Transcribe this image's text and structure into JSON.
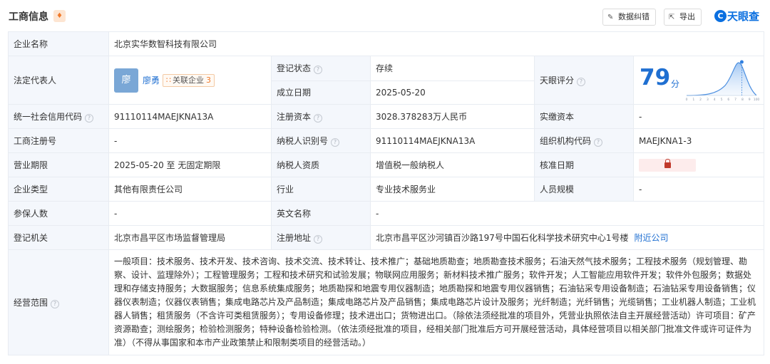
{
  "header": {
    "title": "工商信息",
    "bell_icon": "bell-icon",
    "data_correction_label": "数据纠错",
    "export_label": "导出",
    "logo_text": "天眼查"
  },
  "company": {
    "name_label": "企业名称",
    "name": "北京实华数智科技有限公司",
    "legal_rep_label": "法定代表人",
    "legal_rep_avatar_char": "廖",
    "legal_rep_name": "廖勇",
    "related_companies_label": "关联企业",
    "related_companies_count": "3",
    "reg_status_label": "登记状态",
    "reg_status": "存续",
    "established_label": "成立日期",
    "established": "2025-05-20",
    "tianyan_score_label": "天眼评分",
    "tianyan_score": "79",
    "tianyan_score_unit": "分",
    "credit_code_label": "统一社会信用代码",
    "credit_code": "91110114MAEJKNA13A",
    "reg_capital_label": "注册资本",
    "reg_capital": "3028.378283万人民币",
    "paid_capital_label": "实缴资本",
    "paid_capital": "-",
    "biz_reg_no_label": "工商注册号",
    "biz_reg_no": "-",
    "taxpayer_id_label": "纳税人识别号",
    "taxpayer_id": "91110114MAEJKNA13A",
    "org_code_label": "组织机构代码",
    "org_code": "MAEJKNA1-3",
    "term_label": "营业期限",
    "term": "2025-05-20 至 无固定期限",
    "taxpayer_qual_label": "纳税人资质",
    "taxpayer_qual": "增值税一般纳税人",
    "approval_date_label": "核准日期",
    "company_type_label": "企业类型",
    "company_type": "其他有限责任公司",
    "industry_label": "行业",
    "industry": "专业技术服务业",
    "staff_size_label": "人员规模",
    "staff_size": "-",
    "insured_label": "参保人数",
    "insured": "-",
    "english_name_label": "英文名称",
    "english_name": "-",
    "reg_authority_label": "登记机关",
    "reg_authority": "北京市昌平区市场监督管理局",
    "reg_address_label": "注册地址",
    "reg_address": "北京市昌平区沙河镇百沙路197号中国石化科学技术研究中心1号楼",
    "nearby_label": "附近公司",
    "scope_label": "经营范围",
    "scope": "一般项目：技术服务、技术开发、技术咨询、技术交流、技术转让、技术推广；基础地质勘查；地质勘查技术服务；石油天然气技术服务；工程技术服务（规划管理、勘察、设计、监理除外）；工程管理服务；工程和技术研究和试验发展；物联网应用服务；新材料技术推广服务；软件开发；人工智能应用软件开发；软件外包服务；数据处理和存储支持服务；大数据服务；信息系统集成服务；地质勘探和地震专用仪器制造；地质勘探和地震专用仪器销售；石油钻采专用设备制造；石油钻采专用设备销售；仪器仪表制造；仪器仪表销售；集成电路芯片及产品制造；集成电路芯片及产品销售；集成电路芯片设计及服务；光纤制造；光纤销售；光缆销售；工业机器人制造；工业机器人销售；租赁服务（不含许可类租赁服务）；专用设备修理；技术进出口；货物进出口。（除依法须经批准的项目外，凭营业执照依法自主开展经营活动）许可项目：矿产资源勘查；测绘服务；检验检测服务；特种设备检验检测。（依法须经批准的项目，经相关部门批准后方可开展经营活动，具体经营项目以相关部门批准文件或许可证件为准）（不得从事国家和本市产业政策禁止和限制类项目的经营活动。）"
  },
  "score_chart": {
    "x_ticks": [
      "0",
      "1",
      "2",
      "3",
      "4",
      "5",
      "6",
      "7",
      "8",
      "9",
      "100"
    ],
    "marker_value": 79
  },
  "colors": {
    "accent": "#1f6fd1",
    "status_green": "#1ea74f",
    "label_bg": "#f4f7fc",
    "brand_orange": "#f07a2a"
  }
}
